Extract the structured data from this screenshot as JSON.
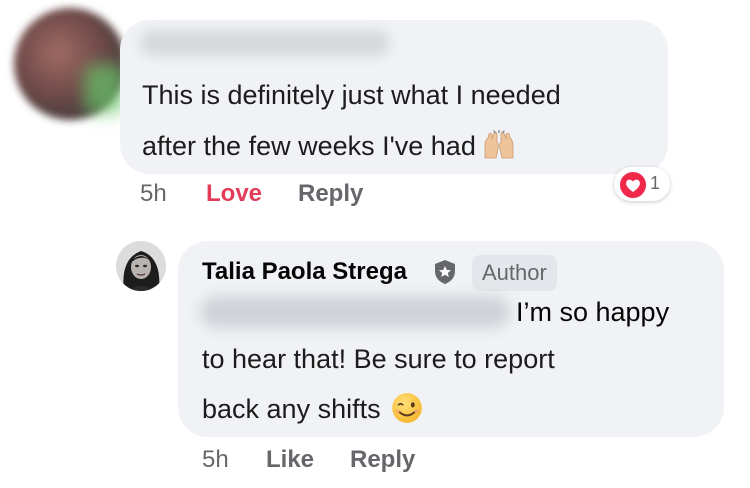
{
  "comment1": {
    "text_line1": "This is definitely just what I needed",
    "text_line2": "after the few weeks I've had",
    "emoji": "raising-hands-emoji",
    "time": "5h",
    "love_label": "Love",
    "reply_label": "Reply",
    "reaction": {
      "icon": "heart-icon",
      "count": "1",
      "color": "#f02849"
    }
  },
  "reply": {
    "author_name": "Talia Paola Strega",
    "badge": "Author",
    "text_line1_visible": "I’m so happy",
    "text_line2": "to hear that! Be sure to report",
    "text_line3": "back any shifts",
    "emoji": "winking-face-emoji",
    "time": "5h",
    "like_label": "Like",
    "reply_label": "Reply"
  },
  "colors": {
    "bubble": "#f0f2f5",
    "love": "#e23c59",
    "muted": "#65676b"
  }
}
